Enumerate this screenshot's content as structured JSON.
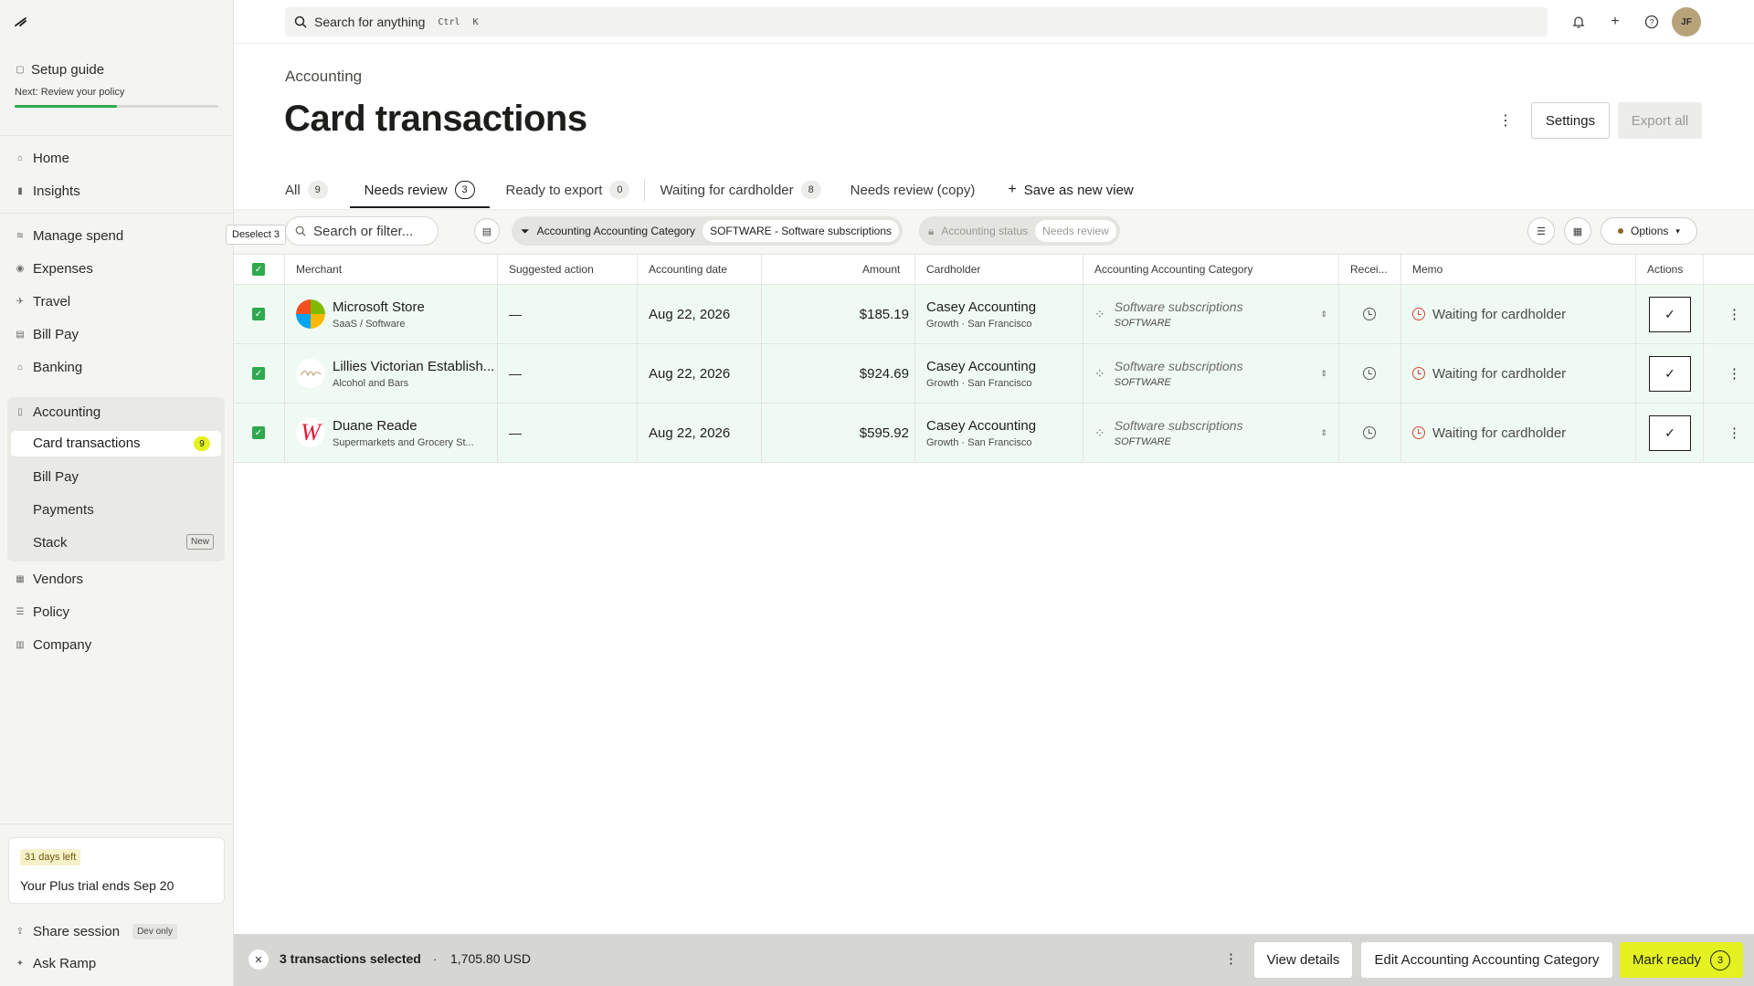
{
  "sidebar": {
    "setup": {
      "title": "Setup guide",
      "subtitle": "Next: Review your policy",
      "progress": 0.5
    },
    "items": [
      {
        "label": "Home",
        "icon": "home-icon"
      },
      {
        "label": "Insights",
        "icon": "chart-icon"
      },
      {
        "label": "Manage spend",
        "icon": "layers-icon"
      },
      {
        "label": "Expenses",
        "icon": "receipt-icon"
      },
      {
        "label": "Travel",
        "icon": "plane-icon"
      },
      {
        "label": "Bill Pay",
        "icon": "bill-icon"
      },
      {
        "label": "Banking",
        "icon": "bank-icon"
      },
      {
        "label": "Accounting",
        "icon": "book-icon"
      },
      {
        "label": "Vendors",
        "icon": "vendor-icon"
      },
      {
        "label": "Policy",
        "icon": "sliders-icon"
      },
      {
        "label": "Company",
        "icon": "building-icon"
      }
    ],
    "accounting_sub": [
      {
        "label": "Card transactions",
        "badge": "9"
      },
      {
        "label": "Bill Pay"
      },
      {
        "label": "Payments"
      },
      {
        "label": "Stack",
        "badge": "New"
      }
    ],
    "trial": {
      "tag": "31 days left",
      "text": "Your Plus trial ends Sep 20"
    },
    "footer": [
      {
        "label": "Share session",
        "tag": "Dev only"
      },
      {
        "label": "Ask Ramp"
      }
    ]
  },
  "topbar": {
    "search_placeholder": "Search for anything",
    "shortcut_ctrl": "Ctrl",
    "shortcut_key": "K",
    "avatar": "JF"
  },
  "header": {
    "breadcrumb": "Accounting",
    "title": "Card transactions",
    "settings_label": "Settings",
    "export_label": "Export all"
  },
  "tabs": [
    {
      "label": "All",
      "count": "9"
    },
    {
      "label": "Needs review",
      "count": "3"
    },
    {
      "label": "Ready to export",
      "count": "0"
    },
    {
      "label": "Waiting for cardholder",
      "count": "8"
    },
    {
      "label": "Needs review (copy)"
    },
    {
      "label": "Save as new view"
    }
  ],
  "filters": {
    "search_placeholder": "Search or filter...",
    "chip1_label": "Accounting Accounting Category",
    "chip1_value": "SOFTWARE - Software subscriptions",
    "chip2_label": "Accounting status",
    "chip2_value": "Needs review",
    "options_label": "Options",
    "tooltip": "Deselect 3"
  },
  "table": {
    "headers": {
      "merchant": "Merchant",
      "suggested": "Suggested action",
      "date": "Accounting date",
      "amount": "Amount",
      "cardholder": "Cardholder",
      "category": "Accounting Accounting Category",
      "receipt": "Recei...",
      "memo": "Memo",
      "actions": "Actions"
    },
    "rows": [
      {
        "merchant": "Microsoft Store",
        "merchant_sub": "SaaS / Software",
        "suggested": "—",
        "date": "Aug 22, 2026",
        "amount": "$185.19",
        "cardholder": "Casey Accounting",
        "cardholder_sub": "Growth · San Francisco",
        "category": "Software subscriptions",
        "category_sub": "SOFTWARE",
        "memo": "Waiting for cardholder"
      },
      {
        "merchant": "Lillies Victorian Establish...",
        "merchant_sub": "Alcohol and Bars",
        "suggested": "—",
        "date": "Aug 22, 2026",
        "amount": "$924.69",
        "cardholder": "Casey Accounting",
        "cardholder_sub": "Growth · San Francisco",
        "category": "Software subscriptions",
        "category_sub": "SOFTWARE",
        "memo": "Waiting for cardholder"
      },
      {
        "merchant": "Duane Reade",
        "merchant_sub": "Supermarkets and Grocery St...",
        "suggested": "—",
        "date": "Aug 22, 2026",
        "amount": "$595.92",
        "cardholder": "Casey Accounting",
        "cardholder_sub": "Growth · San Francisco",
        "category": "Software subscriptions",
        "category_sub": "SOFTWARE",
        "memo": "Waiting for cardholder"
      }
    ]
  },
  "bottombar": {
    "selected": "3 transactions selected",
    "separator": "·",
    "total": "1,705.80 USD",
    "view_details": "View details",
    "edit_category": "Edit Accounting Accounting Category",
    "mark_ready": "Mark ready",
    "mark_ready_count": "3"
  },
  "colors": {
    "accent": "#e4f222",
    "success": "#2fa84f",
    "warning": "#d2453a"
  }
}
